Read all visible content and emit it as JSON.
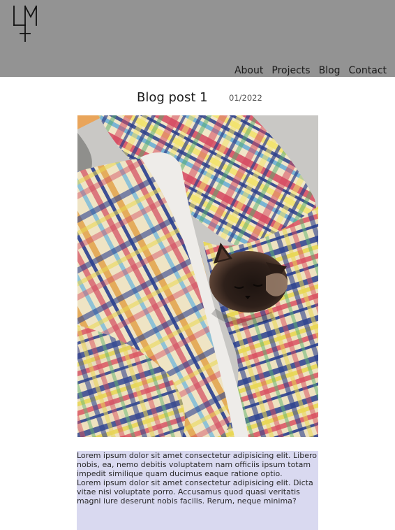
{
  "header": {
    "logo_name": "lm-monogram-logo",
    "nav": [
      {
        "label": "About"
      },
      {
        "label": "Projects"
      },
      {
        "label": "Blog"
      },
      {
        "label": "Contact"
      }
    ]
  },
  "post": {
    "title": "Blog post 1",
    "date": "01/2022",
    "photo_subject": "cat sleeping under plaid duvet",
    "paragraphs": [
      "Lorem ipsum dolor sit amet consectetur adipisicing elit. Libero nobis, ea, nemo debitis voluptatem nam officiis ipsum totam impedit similique quam ducimus eaque ratione optio.",
      "Lorem ipsum dolor sit amet consectetur adipisicing elit. Dicta vitae nisi voluptate porro. Accusamus quod quasi veritatis magni iure deserunt nobis facilis. Rerum, neque minima?"
    ]
  },
  "colors": {
    "header_bg": "#939393",
    "text_highlight": "#d9d9f0"
  }
}
